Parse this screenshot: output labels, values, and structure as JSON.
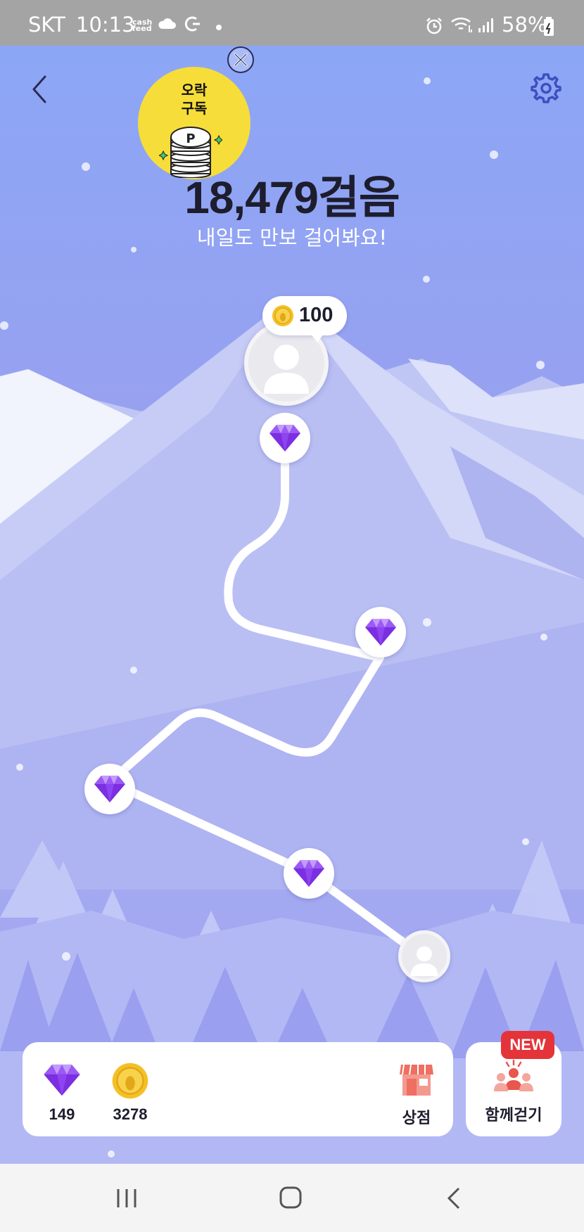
{
  "status_bar": {
    "carrier": "SKT",
    "time": "10:13",
    "cashfeed_label": "cash\nfeed",
    "battery": "58%"
  },
  "header": {
    "back_icon": "chevron-left-icon",
    "settings_icon": "gear-icon"
  },
  "promo": {
    "text": "오락\n구독",
    "coin_letter": "P",
    "close_icon": "close-circle-icon"
  },
  "steps": {
    "count_text": "18,479걸음",
    "subtitle": "내일도 만보 걸어봐요!"
  },
  "course": {
    "reward_value": "100",
    "reward_icon": "foot-coin-icon",
    "summit_icon": "avatar-icon",
    "checkpoint_icon": "gem-icon",
    "start_icon": "avatar-icon"
  },
  "wallet": {
    "gems": "149",
    "gem_icon": "gem-icon",
    "coins": "3278",
    "coin_icon": "foot-coin-icon",
    "shop_label": "상점",
    "shop_icon": "store-icon"
  },
  "walk_together": {
    "label": "함께걷기",
    "badge": "NEW",
    "icon": "people-icon"
  },
  "colors": {
    "sky": "#8ca6f6",
    "gem": "#8e44f0",
    "coin": "#f5c026",
    "badge": "#e5333a",
    "promo": "#f7dd3a"
  }
}
